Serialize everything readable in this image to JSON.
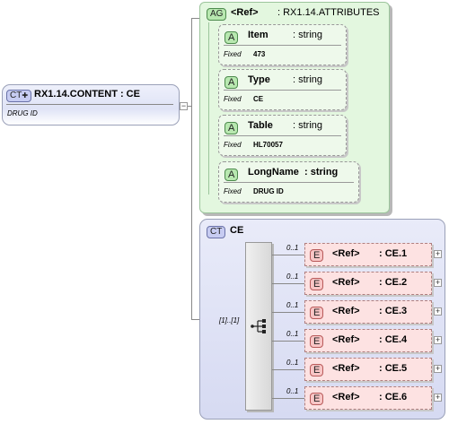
{
  "root": {
    "badge": "CT",
    "title": "RX1.14.CONTENT : CE",
    "description": "DRUG ID"
  },
  "attribute_group": {
    "badge": "AG",
    "ref": "<Ref>",
    "name": ": RX1.14.ATTRIBUTES",
    "attributes": [
      {
        "badge": "A",
        "name": "Item",
        "type": ": string",
        "fixed_label": "Fixed",
        "fixed_value": "473"
      },
      {
        "badge": "A",
        "name": "Type",
        "type": ": string",
        "fixed_label": "Fixed",
        "fixed_value": "CE"
      },
      {
        "badge": "A",
        "name": "Table",
        "type": ": string",
        "fixed_label": "Fixed",
        "fixed_value": "HL70057"
      },
      {
        "badge": "A",
        "name": "LongName",
        "type": ": string",
        "fixed_label": "Fixed",
        "fixed_value": "DRUG ID"
      }
    ]
  },
  "complex_type": {
    "badge": "CT",
    "name": "CE",
    "sequence_cardinality": "[1]..[1]",
    "elements": [
      {
        "badge": "E",
        "ref": "<Ref>",
        "name": ": CE.1",
        "cardinality": "0..1"
      },
      {
        "badge": "E",
        "ref": "<Ref>",
        "name": ": CE.2",
        "cardinality": "0..1"
      },
      {
        "badge": "E",
        "ref": "<Ref>",
        "name": ": CE.3",
        "cardinality": "0..1"
      },
      {
        "badge": "E",
        "ref": "<Ref>",
        "name": ": CE.4",
        "cardinality": "0..1"
      },
      {
        "badge": "E",
        "ref": "<Ref>",
        "name": ": CE.5",
        "cardinality": "0..1"
      },
      {
        "badge": "E",
        "ref": "<Ref>",
        "name": ": CE.6",
        "cardinality": "0..1"
      }
    ],
    "expand_symbol": "+"
  },
  "collapse_symbol": "−"
}
